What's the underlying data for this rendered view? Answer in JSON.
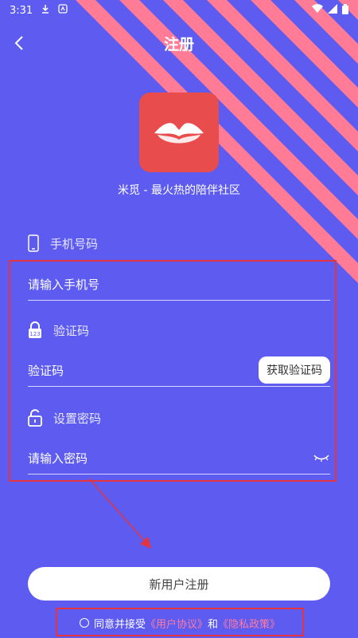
{
  "status": {
    "time": "3:31"
  },
  "header": {
    "title": "注册"
  },
  "app": {
    "slogan": "米觅 - 最火热的陪伴社区"
  },
  "form": {
    "phone_label": "手机号码",
    "phone_placeholder": "请输入手机号",
    "code_label": "验证码",
    "code_placeholder": "验证码",
    "get_code_button": "获取验证码",
    "password_label": "设置密码",
    "password_placeholder": "请输入密码"
  },
  "actions": {
    "register_button": "新用户注册"
  },
  "agreement": {
    "prefix": "同意并接受",
    "user_agreement": "《用户协议》",
    "and": "和",
    "privacy_policy": "《隐私政策》"
  },
  "colors": {
    "background": "#5e5cf0",
    "stripe": "#ff7b96",
    "highlight": "#e3343f",
    "logo": "#e84c4c"
  }
}
